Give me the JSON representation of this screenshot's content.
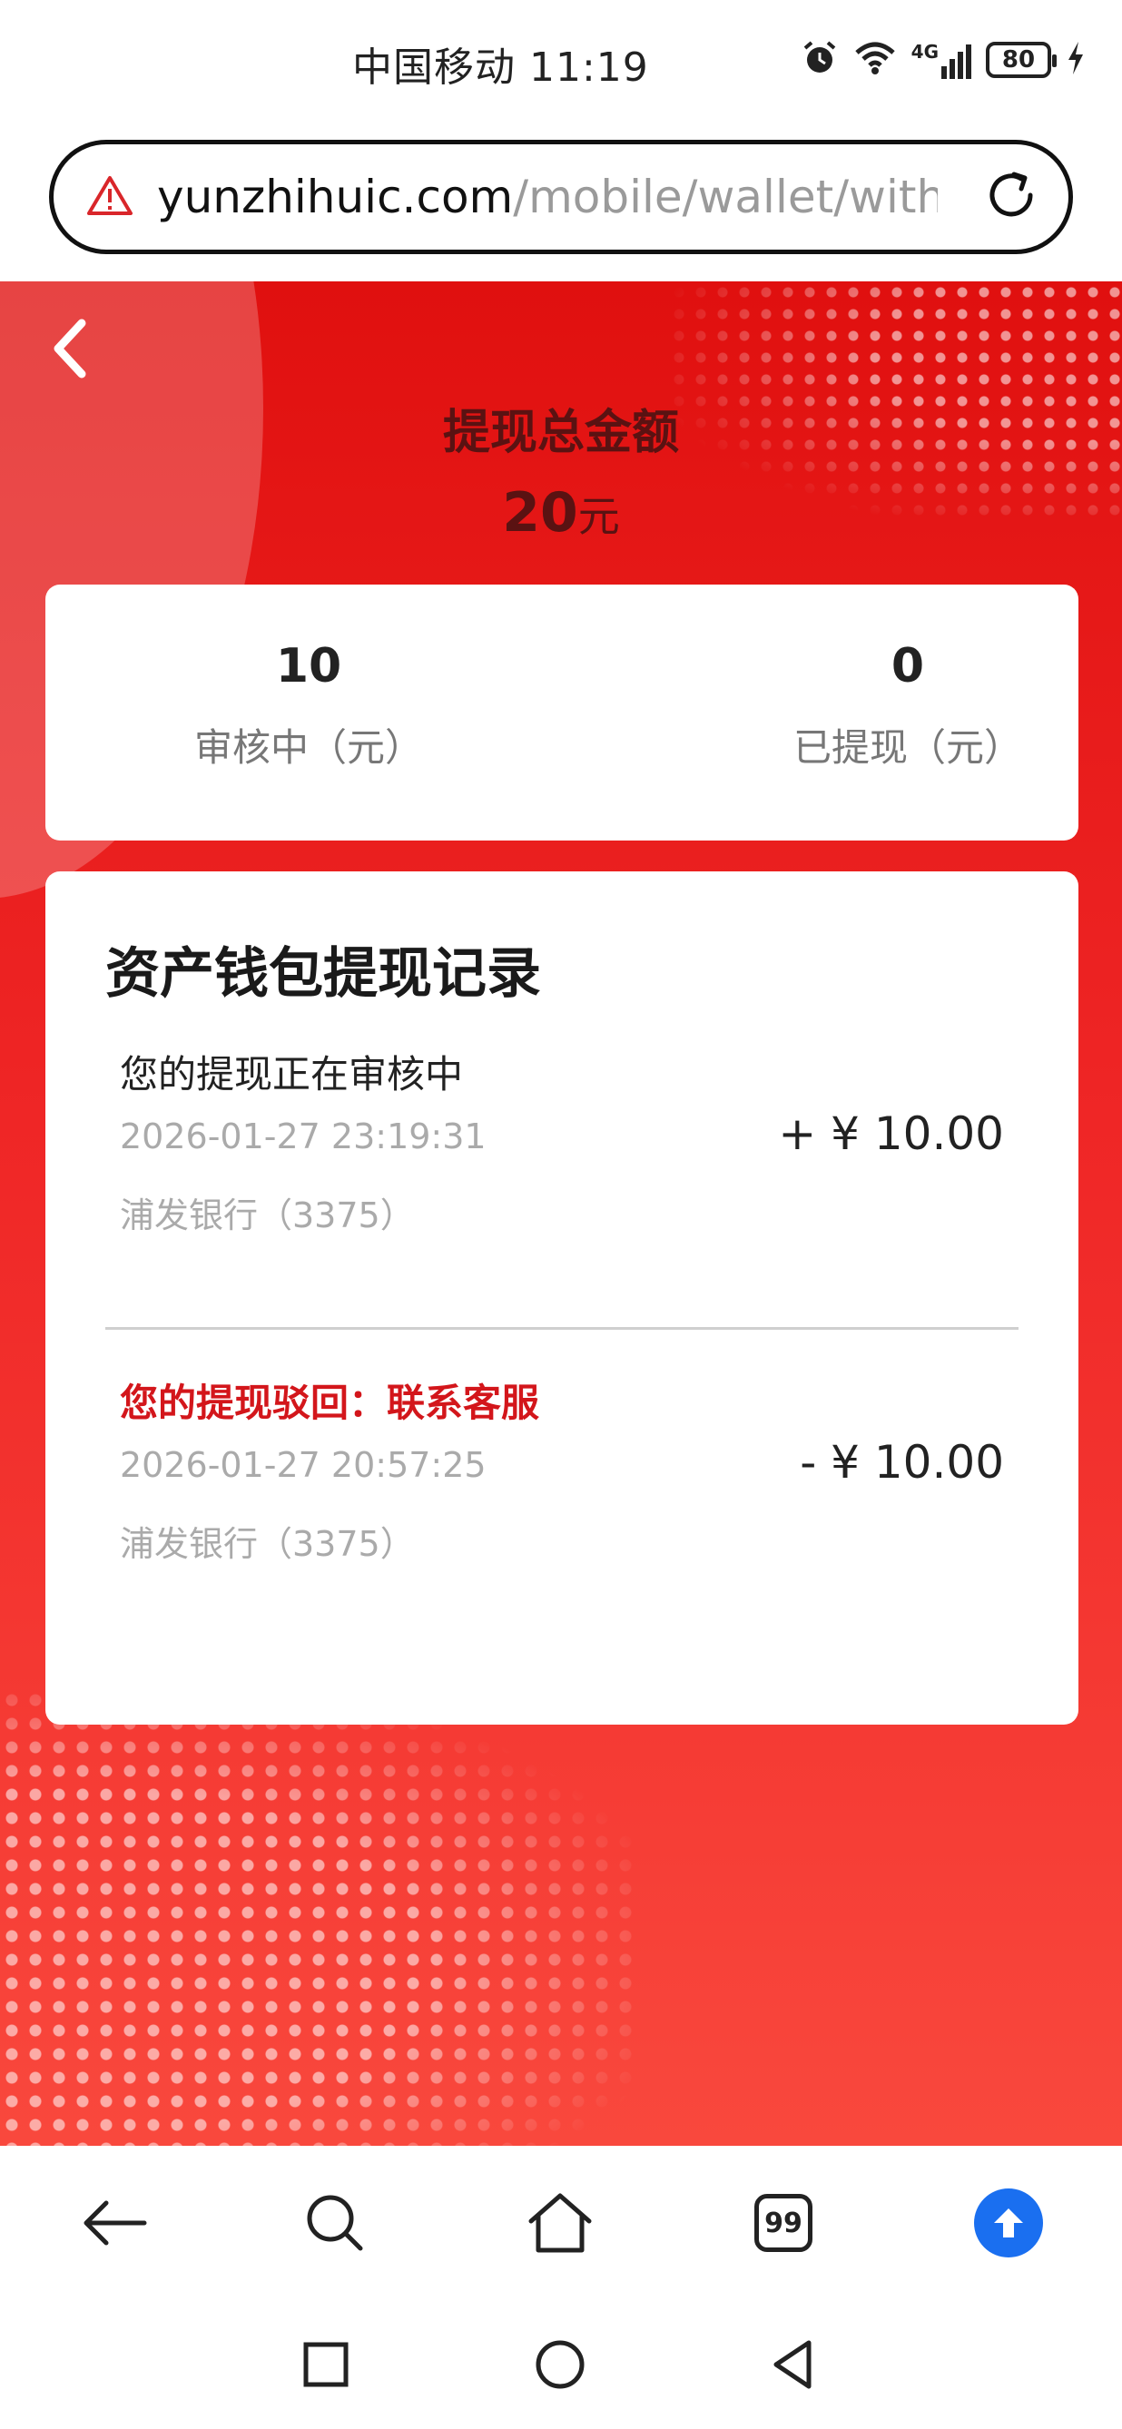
{
  "status_bar": {
    "carrier_time": "中国移动 11:19",
    "network": "4G",
    "battery": "80",
    "icons": [
      "alarm-icon",
      "wifi-icon",
      "signal-icon",
      "battery-icon",
      "charging-icon"
    ]
  },
  "address_bar": {
    "domain": "yunzhihuic.com",
    "path": "/mobile/wallet/withlo",
    "icons": [
      "warning-icon",
      "reload-icon"
    ]
  },
  "summary": {
    "title": "提现总金额",
    "total_value": "20",
    "total_unit": "元",
    "reviewing_value": "10",
    "reviewing_label": "审核中（元）",
    "withdrawn_value": "0",
    "withdrawn_label": "已提现（元）"
  },
  "records": {
    "title": "资产钱包提现记录",
    "items": [
      {
        "status": "您的提现正在审核中",
        "time": "2026-01-27 23:19:31",
        "bank": "浦发银行（3375）",
        "amount": "+ ¥ 10.00"
      },
      {
        "status": "您的提现驳回：联系客服",
        "time": "2026-01-27 20:57:25",
        "bank": "浦发银行（3375）",
        "amount": "- ¥ 10.00"
      }
    ]
  },
  "toolbar": {
    "tabs_count": "99",
    "icons": [
      "back-arrow-icon",
      "search-icon",
      "home-icon",
      "tabs-icon",
      "upload-icon"
    ]
  },
  "colors": {
    "accent_red": "#e0100f",
    "rejected_text": "#d3161b",
    "upload_blue": "#1a6ff0"
  }
}
